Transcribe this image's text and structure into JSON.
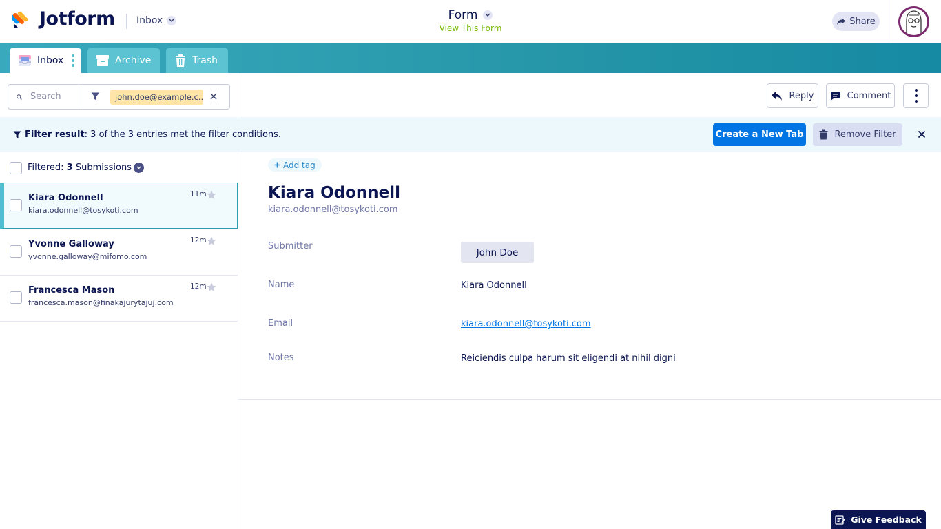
{
  "header": {
    "logo_text": "Jotform",
    "inbox_dropdown": "Inbox",
    "form_title": "Form",
    "view_form_link": "View This Form",
    "share_label": "Share"
  },
  "tabs": [
    {
      "label": "Inbox"
    },
    {
      "label": "Archive"
    },
    {
      "label": "Trash"
    }
  ],
  "search": {
    "placeholder": "Search",
    "filter_chip": "john.doe@example.c..."
  },
  "actions": {
    "reply": "Reply",
    "comment": "Comment"
  },
  "filter_banner": {
    "label": "Filter result",
    "text": ": 3 of the 3 entries met the filter conditions.",
    "create_tab": "Create a New Tab",
    "remove_filter": "Remove Filter"
  },
  "list": {
    "filtered_prefix": "Filtered: ",
    "count": "3",
    "suffix": " Submissions",
    "items": [
      {
        "name": "Kiara Odonnell",
        "email": "kiara.odonnell@tosykoti.com",
        "time": "11m",
        "selected": true
      },
      {
        "name": "Yvonne Galloway",
        "email": "yvonne.galloway@mifomo.com",
        "time": "12m",
        "selected": false
      },
      {
        "name": "Francesca Mason",
        "email": "francesca.mason@finakajurytajuj.com",
        "time": "12m",
        "selected": false
      }
    ]
  },
  "detail": {
    "add_tag": "Add tag",
    "name": "Kiara Odonnell",
    "email": "kiara.odonnell@tosykoti.com",
    "fields": [
      {
        "label": "Submitter",
        "value": "John Doe"
      },
      {
        "label": "Name",
        "value": "Kiara Odonnell"
      },
      {
        "label": "Email",
        "value": "kiara.odonnell@tosykoti.com"
      },
      {
        "label": "Notes",
        "value": "Reiciendis culpa harum sit eligendi at nihil digni"
      }
    ]
  },
  "feedback_label": "Give Feedback",
  "colors": {
    "accent_blue": "#0075e3",
    "tab_teal": "#2596a8",
    "navy": "#0a1551",
    "chip_yellow": "#ffe6a8",
    "link_green": "#78bb07"
  }
}
